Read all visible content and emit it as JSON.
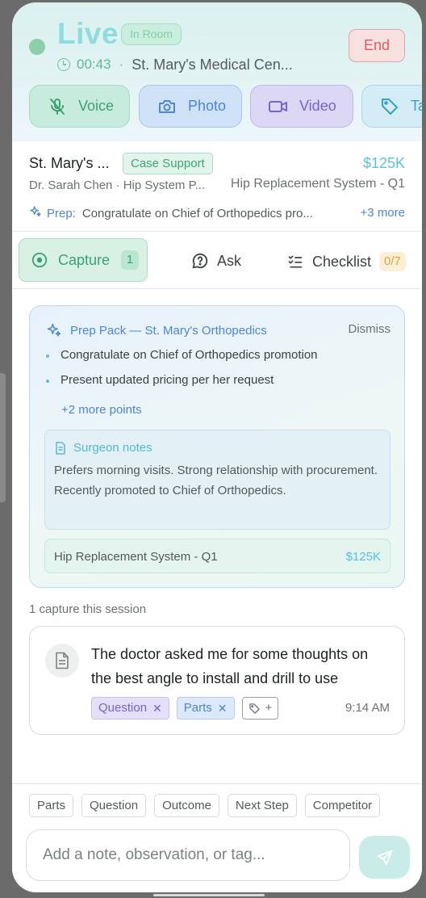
{
  "header": {
    "live_label": "Live",
    "status_badge": "In Room",
    "timer": "00:43",
    "separator": "·",
    "location": "St. Mary's Medical Cen...",
    "end_label": "End"
  },
  "media_buttons": [
    {
      "label": "Voice",
      "icon": "mic-off-icon"
    },
    {
      "label": "Photo",
      "icon": "camera-icon"
    },
    {
      "label": "Video",
      "icon": "video-icon"
    },
    {
      "label": "Ta",
      "icon": "tag-icon"
    }
  ],
  "account": {
    "name": "St. Mary's ...",
    "badge": "Case Support",
    "amount": "$125K",
    "doctor": "Dr. Sarah Chen · Hip System P...",
    "product": "Hip Replacement System - Q1",
    "prep_label": "Prep:",
    "prep_text": "Congratulate on Chief of Orthopedics pro...",
    "prep_more": "+3 more"
  },
  "tabs": {
    "capture_label": "Capture",
    "capture_count": "1",
    "ask_label": "Ask",
    "checklist_label": "Checklist",
    "checklist_count": "0/7"
  },
  "prep_pack": {
    "title": "Prep Pack — St. Mary's Orthopedics",
    "dismiss": "Dismiss",
    "points": [
      "Congratulate on Chief of Orthopedics promotion",
      "Present updated pricing per her request"
    ],
    "more_points": "+2 more points",
    "notes_title": "Surgeon notes",
    "notes_body": "Prefers morning visits. Strong relationship with procurement. Recently promoted to Chief of Orthopedics.",
    "deal_name": "Hip Replacement System - Q1",
    "deal_amount": "$125K"
  },
  "session": {
    "label": "1 capture this session",
    "capture_text": "The doctor asked me for some thoughts on the best angle to install and drill to use",
    "tags": [
      "Question",
      "Parts"
    ],
    "add_tag": "+",
    "time": "9:14 AM"
  },
  "footer": {
    "chips": [
      "Parts",
      "Question",
      "Outcome",
      "Next Step",
      "Competitor"
    ],
    "placeholder": "Add a note, observation, or tag..."
  }
}
